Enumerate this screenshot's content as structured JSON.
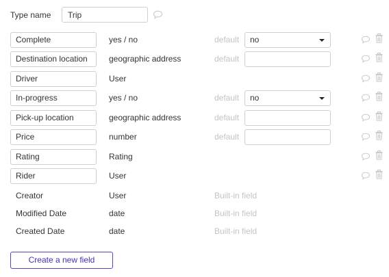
{
  "type_name": {
    "label": "Type name",
    "value": "Trip"
  },
  "default_label": "default",
  "builtin_label": "Built-in field",
  "fields": [
    {
      "name": "Complete",
      "type": "yes / no",
      "default_kind": "select",
      "default_value": "no"
    },
    {
      "name": "Destination location",
      "type": "geographic address",
      "default_kind": "text",
      "default_value": ""
    },
    {
      "name": "Driver",
      "type": "User",
      "default_kind": "none"
    },
    {
      "name": "In-progress",
      "type": "yes / no",
      "default_kind": "select",
      "default_value": "no"
    },
    {
      "name": "Pick-up location",
      "type": "geographic address",
      "default_kind": "text",
      "default_value": ""
    },
    {
      "name": "Price",
      "type": "number",
      "default_kind": "text",
      "default_value": ""
    },
    {
      "name": "Rating",
      "type": "Rating",
      "default_kind": "none"
    },
    {
      "name": "Rider",
      "type": "User",
      "default_kind": "none"
    }
  ],
  "builtin_fields": [
    {
      "name": "Creator",
      "type": "User"
    },
    {
      "name": "Modified Date",
      "type": "date"
    },
    {
      "name": "Created Date",
      "type": "date"
    }
  ],
  "create_button_label": "Create a new field",
  "icons": {
    "comment": "comment-icon",
    "delete": "trash-icon"
  },
  "colors": {
    "accent": "#5b3fc4",
    "border": "#cfcfcf",
    "muted": "#c4c4c4",
    "icon": "#c9c9c9"
  }
}
